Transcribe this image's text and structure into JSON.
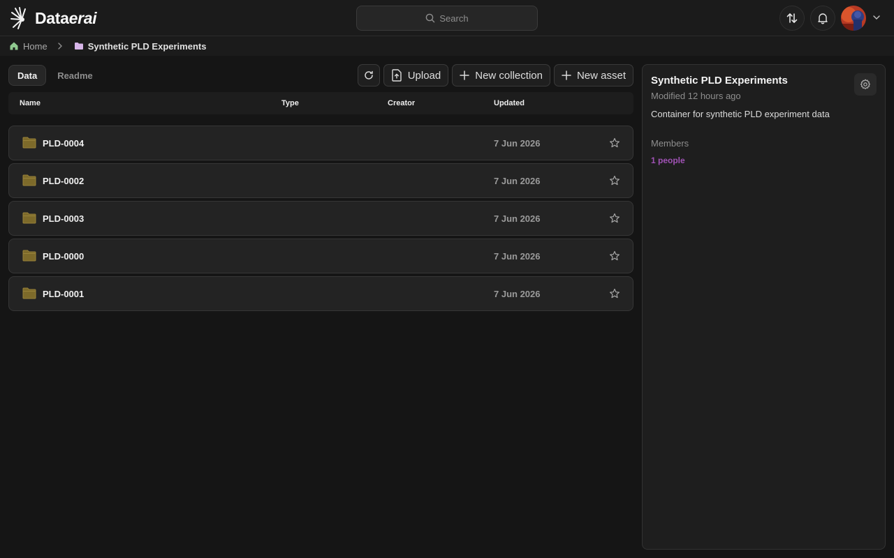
{
  "app": {
    "brand_plain": "Data",
    "brand_italic": "erai"
  },
  "header": {
    "search_placeholder": "Search"
  },
  "breadcrumb": {
    "home": "Home",
    "current": "Synthetic PLD Experiments"
  },
  "tabs": [
    {
      "label": "Data",
      "active": true
    },
    {
      "label": "Readme",
      "active": false
    }
  ],
  "toolbar": {
    "upload_label": "Upload",
    "new_collection_label": "New collection",
    "new_asset_label": "New asset"
  },
  "table": {
    "columns": [
      "Name",
      "Type",
      "Creator",
      "Updated"
    ],
    "rows": [
      {
        "name": "PLD-0004",
        "updated": "7 Jun 2026"
      },
      {
        "name": "PLD-0002",
        "updated": "7 Jun 2026"
      },
      {
        "name": "PLD-0003",
        "updated": "7 Jun 2026"
      },
      {
        "name": "PLD-0000",
        "updated": "7 Jun 2026"
      },
      {
        "name": "PLD-0001",
        "updated": "7 Jun 2026"
      }
    ]
  },
  "panel": {
    "title": "Synthetic PLD Experiments",
    "modified": "Modified 12 hours ago",
    "description": "Container for synthetic PLD experiment data",
    "members_label": "Members",
    "members_count": "1 people"
  },
  "colors": {
    "background": "#151515",
    "folder": "#7d6a2a",
    "accent": "#a052b5",
    "home_icon": "#8fc98f",
    "collection_icon": "#d7b5e8"
  },
  "icons": {
    "logo": "starburst-logo-icon",
    "search": "search-icon",
    "transfer": "transfer-arrows-icon",
    "notifications": "bell-icon",
    "refresh": "refresh-icon",
    "upload": "file-upload-icon",
    "add": "plus-icon",
    "folder": "folder-icon",
    "favorite": "star-icon",
    "settings": "gear-icon"
  }
}
